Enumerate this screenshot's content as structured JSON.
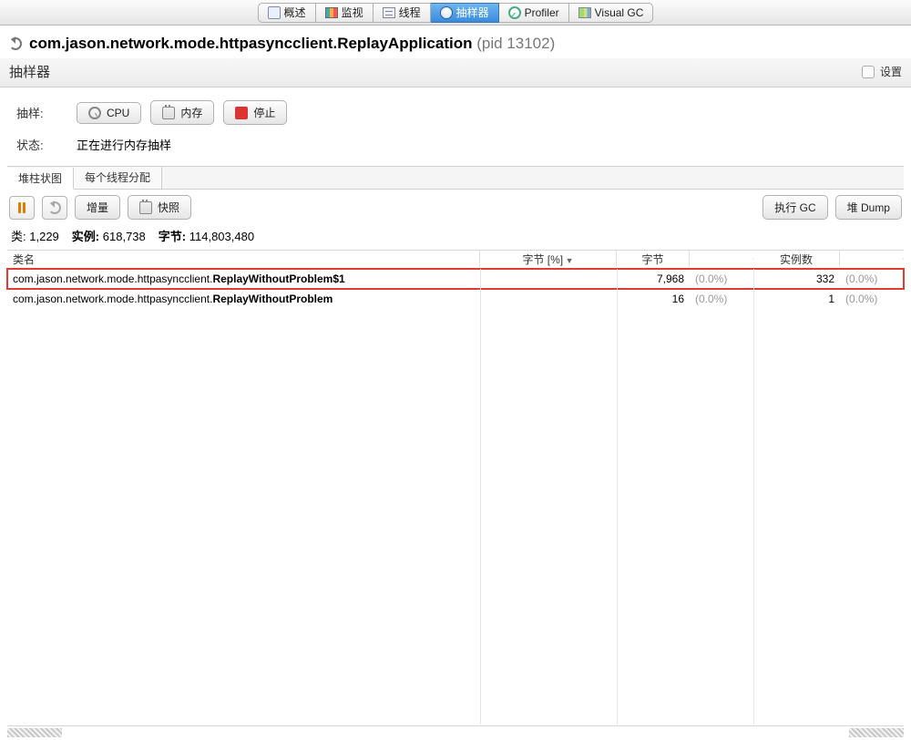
{
  "tabs": {
    "overview": "概述",
    "monitor": "监视",
    "threads": "线程",
    "sampler": "抽样器",
    "profiler": "Profiler",
    "visualgc": "Visual GC"
  },
  "title": {
    "pkg": "com.jason.network.mode.httpasyncclient.",
    "cls": "ReplayApplication",
    "pid": "(pid 13102)"
  },
  "section": {
    "title": "抽样器",
    "settings": "设置"
  },
  "controls": {
    "sample_label": "抽样:",
    "cpu_btn": "CPU",
    "mem_btn": "内存",
    "stop_btn": "停止",
    "state_label": "状态:",
    "state_value": "正在进行内存抽样"
  },
  "inner_tabs": {
    "histogram": "堆柱状图",
    "per_thread": "每个线程分配"
  },
  "toolbar": {
    "delta": "增量",
    "snapshot": "快照",
    "gc": "执行 GC",
    "heapdump": "堆 Dump"
  },
  "stats": {
    "classes_label": "类:",
    "classes_value": "1,229",
    "instances_label": "实例:",
    "instances_value": "618,738",
    "bytes_label": "字节:",
    "bytes_value": "114,803,480"
  },
  "columns": {
    "classname": "类名",
    "bytes_pct": "字节 [%]",
    "bytes": "字节",
    "instances": "实例数"
  },
  "rows": [
    {
      "pkg": "com.jason.network.mode.httpasyncclient.",
      "cls": "ReplayWithoutProblem$1",
      "bytes": "7,968",
      "bytes_pct": "(0.0%)",
      "instances": "332",
      "instances_pct": "(0.0%)",
      "highlight": true
    },
    {
      "pkg": "com.jason.network.mode.httpasyncclient.",
      "cls": "ReplayWithoutProblem",
      "bytes": "16",
      "bytes_pct": "(0.0%)",
      "instances": "1",
      "instances_pct": "(0.0%)",
      "highlight": false
    }
  ]
}
